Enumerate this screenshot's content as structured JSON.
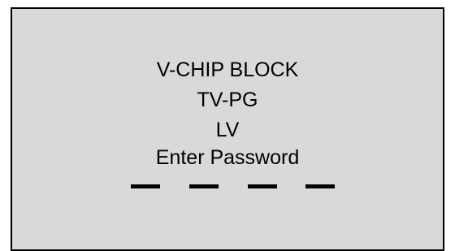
{
  "screen": {
    "title": "V-CHIP BLOCK",
    "rating": "TV-PG",
    "content_flags": "LV",
    "prompt": "Enter Password",
    "password_slots": 4,
    "background_color": "#d9d9d9"
  }
}
